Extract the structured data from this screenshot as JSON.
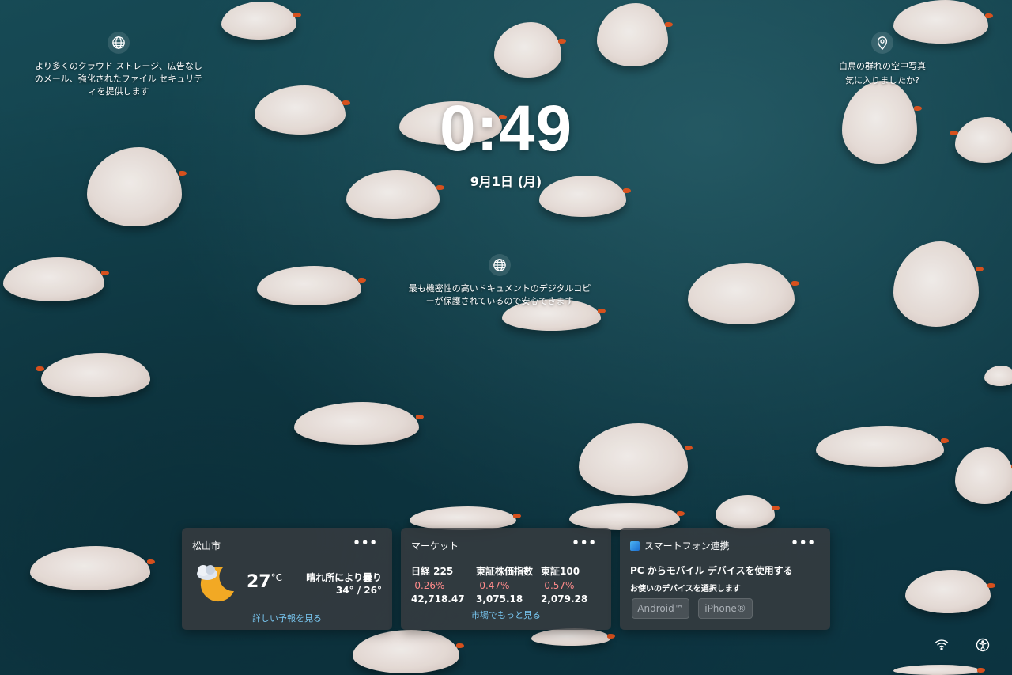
{
  "top_left_widget": {
    "icon": "globe-icon",
    "text": "より多くのクラウド ストレージ、広告なしのメール、強化されたファイル セキュリティを提供します"
  },
  "top_right_widget": {
    "icon": "location-pin-icon",
    "title": "白鳥の群れの空中写真",
    "subtitle": "気に入りましたか?"
  },
  "center_widget": {
    "icon": "globe-icon",
    "text": "最も機密性の高いドキュメントのデジタルコピーが保護されているので安心できます"
  },
  "clock": {
    "time": "0:49",
    "date": "9月1日 (月)"
  },
  "weather": {
    "city": "松山市",
    "more": "•••",
    "temp": "27",
    "unit": "°C",
    "condition": "晴れ所により曇り",
    "range": "34° / 26°",
    "link": "詳しい予報を見る",
    "icon": "partly-cloudy-night-icon"
  },
  "market": {
    "title": "マーケット",
    "more": "•••",
    "items": [
      {
        "name": "日経 225",
        "change": "-0.26%",
        "value": "42,718.47"
      },
      {
        "name": "東証株価指数",
        "change": "-0.47%",
        "value": "3,075.18"
      },
      {
        "name": "東証100",
        "change": "-0.57%",
        "value": "2,079.28"
      }
    ],
    "link": "市場でもっと見る",
    "change_color": "#ff8b8b"
  },
  "phone_link": {
    "title": "スマートフォン連携",
    "more": "•••",
    "heading": "PC からモバイル デバイスを使用する",
    "sub": "お使いのデバイスを選択します",
    "android": "Android™",
    "iphone": "iPhone®",
    "icon": "phone-link-icon"
  },
  "tray": {
    "wifi_icon": "wifi-icon",
    "accessibility_icon": "accessibility-icon"
  },
  "colors": {
    "accent_link": "#78c6f0",
    "card_bg": "#383c40",
    "beak": "#e1521c"
  }
}
